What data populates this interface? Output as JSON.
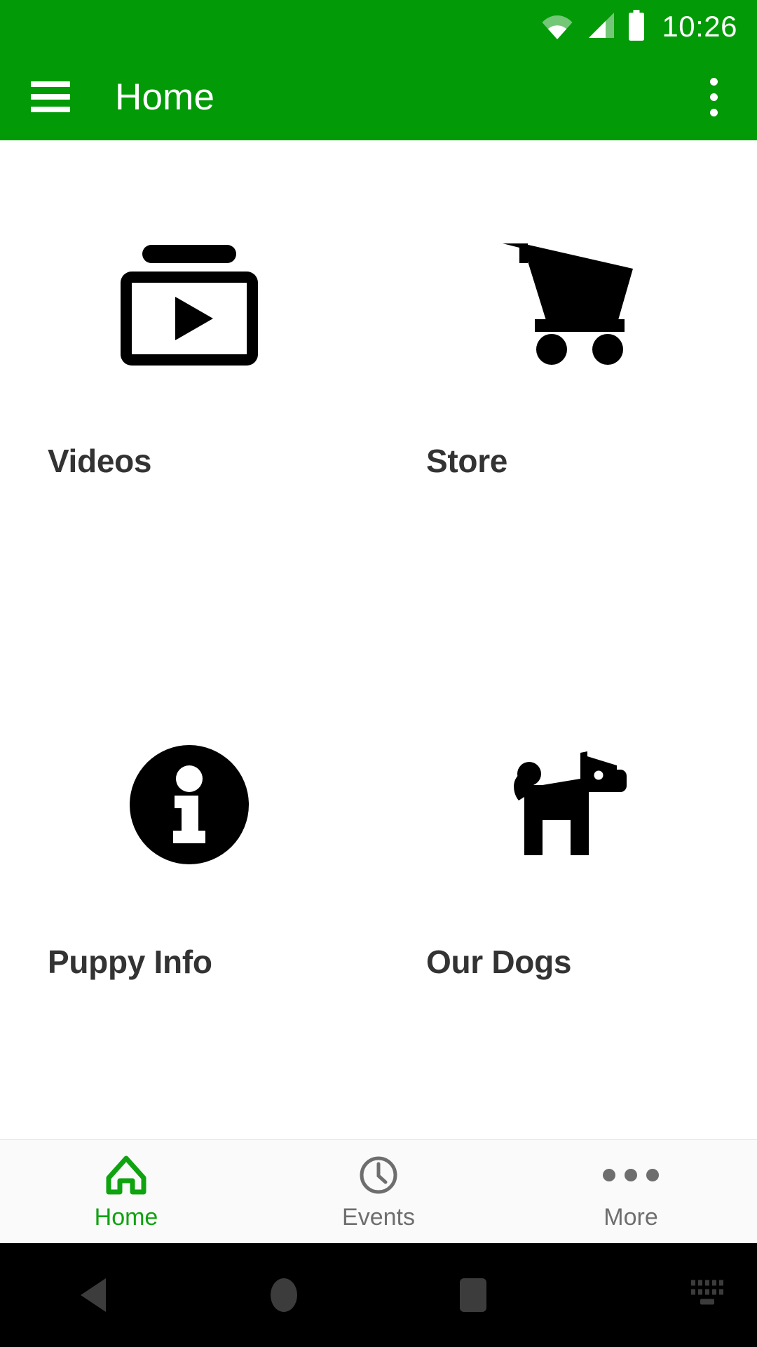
{
  "status_bar": {
    "time": "10:26",
    "icons": [
      "wifi-icon",
      "cellular-signal-icon",
      "battery-icon"
    ],
    "background_color": "#029A06",
    "foreground_color": "#FFFFFF"
  },
  "app_bar": {
    "menu_icon": "hamburger-menu-icon",
    "title": "Home",
    "overflow_icon": "overflow-menu-icon",
    "background_color": "#029A06"
  },
  "main": {
    "tiles": [
      {
        "label": "Videos",
        "icon": "video-library-icon"
      },
      {
        "label": "Store",
        "icon": "shopping-cart-icon"
      },
      {
        "label": "Puppy Info",
        "icon": "info-circle-icon"
      },
      {
        "label": "Our Dogs",
        "icon": "dog-icon"
      }
    ],
    "label_color": "#333333",
    "icon_color": "#000000",
    "background_color": "#FFFFFF"
  },
  "bottom_nav": {
    "active_color": "#10A310",
    "inactive_color": "#6E6E6E",
    "items": [
      {
        "label": "Home",
        "icon": "home-icon",
        "active": true
      },
      {
        "label": "Events",
        "icon": "clock-icon",
        "active": false
      },
      {
        "label": "More",
        "icon": "more-dots-icon",
        "active": false
      }
    ]
  },
  "system_nav": {
    "background_color": "#000000",
    "buttons": [
      "back-icon",
      "home-circle-icon",
      "recents-square-icon",
      "hide-keyboard-icon"
    ]
  }
}
